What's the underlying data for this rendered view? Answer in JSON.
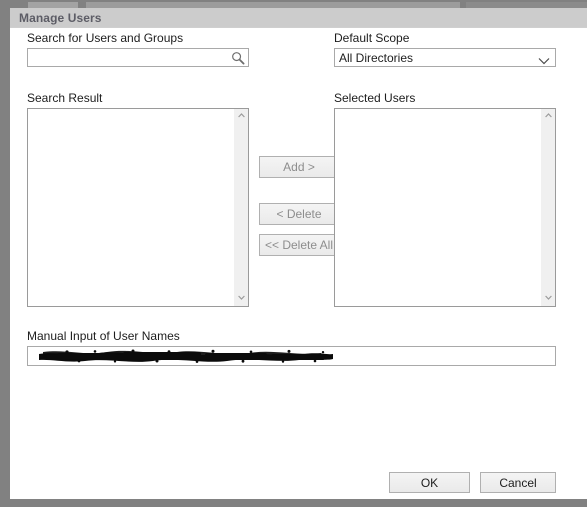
{
  "window": {
    "title": "Manage Users"
  },
  "search": {
    "label": "Search for Users and Groups",
    "value": "",
    "placeholder": "",
    "icon": "search-icon"
  },
  "scope": {
    "label": "Default Scope",
    "selected": "All Directories",
    "options": [
      "All Directories"
    ],
    "icon": "chevron-down-icon"
  },
  "search_result": {
    "label": "Search Result",
    "items": []
  },
  "selected_users": {
    "label": "Selected Users",
    "items": []
  },
  "transfer_buttons": {
    "add_label": "Add >",
    "delete_label": "< Delete",
    "delete_all_label": "<< Delete All"
  },
  "manual_input": {
    "label": "Manual Input of User Names",
    "value": "",
    "placeholder": "",
    "redacted": true
  },
  "footer": {
    "ok_label": "OK",
    "cancel_label": "Cancel"
  },
  "colors": {
    "titlebar_bg": "#cccccc",
    "titlebar_text": "#5d5d66",
    "window_frame": "#818181",
    "body_bg": "#ffffff",
    "field_border": "#a9a9a9",
    "button_face": "#eeeeee",
    "button_border": "#b0b0b0",
    "disabled_text": "#8d8d8d",
    "scrollbar_track": "#f0f0f0",
    "text": "#1d1d1d"
  }
}
